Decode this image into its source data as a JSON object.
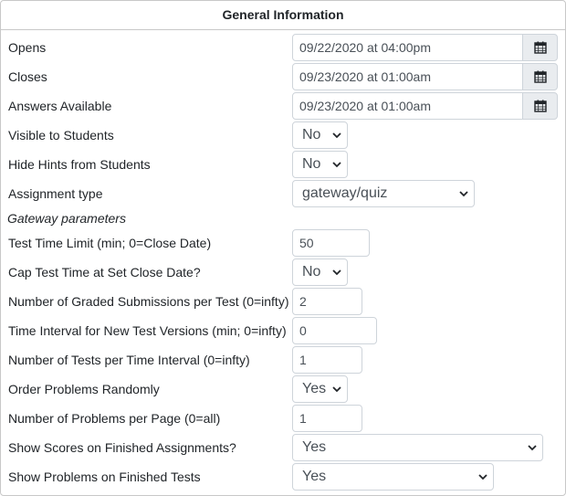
{
  "section_title": "General Information",
  "dates": [
    {
      "label": "Opens",
      "value": "09/22/2020 at 04:00pm",
      "icon": "calendar-icon"
    },
    {
      "label": "Closes",
      "value": "09/23/2020 at 01:00am",
      "icon": "calendar-icon"
    },
    {
      "label": "Answers Available",
      "value": "09/23/2020 at 01:00am",
      "icon": "calendar-icon"
    }
  ],
  "visible_to_students": {
    "label": "Visible to Students",
    "value": "No"
  },
  "hide_hints": {
    "label": "Hide Hints from Students",
    "value": "No"
  },
  "assignment_type": {
    "label": "Assignment type",
    "value": "gateway/quiz"
  },
  "gateway_heading": "Gateway parameters",
  "test_time_limit": {
    "label": "Test Time Limit (min; 0=Close Date)",
    "value": "50"
  },
  "cap_test_time": {
    "label": "Cap Test Time at Set Close Date?",
    "value": "No"
  },
  "graded_submissions": {
    "label": "Number of Graded Submissions per Test (0=infty)",
    "value": "2"
  },
  "time_interval": {
    "label": "Time Interval for New Test Versions (min; 0=infty)",
    "value": "0"
  },
  "tests_per_interval": {
    "label": "Number of Tests per Time Interval (0=infty)",
    "value": "1"
  },
  "order_random": {
    "label": "Order Problems Randomly",
    "value": "Yes"
  },
  "problems_per_page": {
    "label": "Number of Problems per Page (0=all)",
    "value": "1"
  },
  "show_scores": {
    "label": "Show Scores on Finished Assignments?",
    "value": "Yes"
  },
  "show_problems": {
    "label": "Show Problems on Finished Tests",
    "value": "Yes"
  }
}
